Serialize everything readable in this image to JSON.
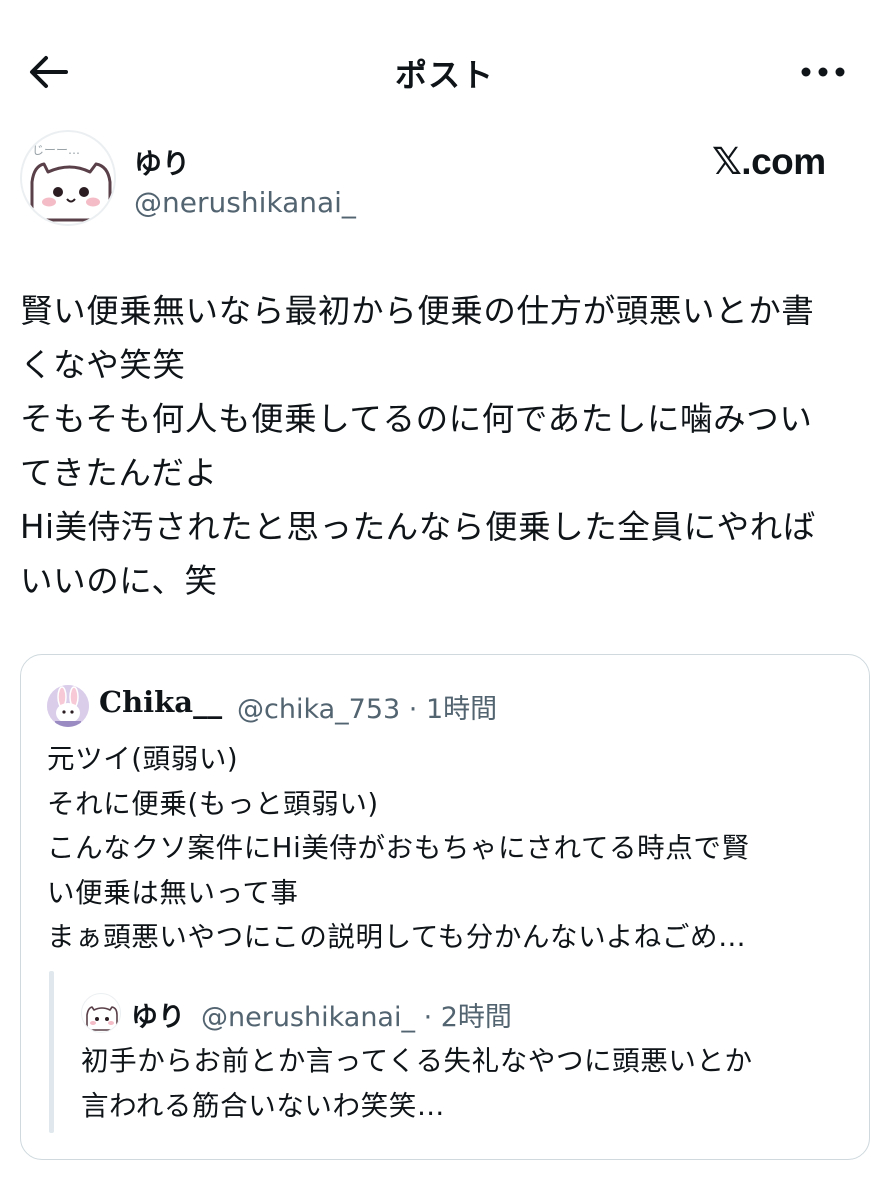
{
  "header": {
    "title": "ポスト"
  },
  "author": {
    "name": "ゆり",
    "handle": "@nerushikanai_",
    "avatar_caption": "じーー…"
  },
  "brand": "𝕏.com",
  "post": {
    "lines": [
      "賢い便乗無いなら最初から便乗の仕方が頭悪いとか書",
      "くなや笑笑",
      "そもそも何人も便乗してるのに何であたしに噛みつい",
      "てきたんだよ",
      "Hi美侍汚されたと思ったんなら便乗した全員にやれば",
      "いいのに、笑"
    ]
  },
  "quote": {
    "name": "Chika__",
    "meta": "@chika_753 · 1時間",
    "lines": [
      "元ツイ(頭弱い)",
      "それに便乗(もっと頭弱い)",
      "こんなクソ案件にHi美侍がおもちゃにされてる時点で賢",
      "い便乗は無いって事",
      "まぁ頭悪いやつにこの説明しても分かんないよねごめ…"
    ],
    "nested": {
      "name": "ゆり",
      "meta": "@nerushikanai_ · 2時間",
      "lines": [
        "初手からお前とか言ってくる失礼なやつに頭悪いとか",
        "言われる筋合いないわ笑笑…"
      ]
    }
  },
  "colors": {
    "text": "#0f1419",
    "muted": "#536471",
    "border": "#cfd9de",
    "avatar_pink": "#f3bcc6"
  },
  "icons": {
    "back": "arrow-left-icon",
    "more": "more-horizontal-icon"
  }
}
